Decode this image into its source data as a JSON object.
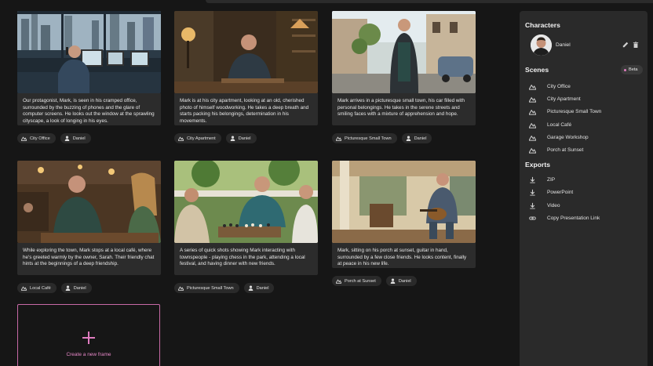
{
  "frames": [
    {
      "description": "Our protagonist, Mark, is seen in his cramped office, surrounded by the buzzing of phones and the glare of computer screens. He looks out the window at the sprawling cityscape, a look of longing in his eyes.",
      "scene_tag": "City Office",
      "character_tag": "Daniel"
    },
    {
      "description": "Mark is at his city apartment, looking at an old, cherished photo of himself woodworking. He takes a deep breath and starts packing his belongings, determination in his movements.",
      "scene_tag": "City Apartment",
      "character_tag": "Daniel"
    },
    {
      "description": "Mark arrives in a picturesque small town, his car filled with personal belongings. He takes in the serene streets and smiling faces with a mixture of apprehension and hope.",
      "scene_tag": "Picturesque Small Town",
      "character_tag": "Daniel"
    },
    {
      "description": "While exploring the town, Mark stops at a local café, where he's greeted warmly by the owner, Sarah. Their friendly chat hints at the beginnings of a deep friendship.",
      "scene_tag": "Local Café",
      "character_tag": "Daniel"
    },
    {
      "description": "A series of quick shots showing Mark interacting with townspeople - playing chess in the park, attending a local festival, and having dinner with new friends.",
      "scene_tag": "Picturesque Small Town",
      "character_tag": "Daniel"
    },
    {
      "description": "Mark, sitting on his porch at sunset, guitar in hand, surrounded by a few close friends. He looks content, finally at peace in his new life.",
      "scene_tag": "Porch at Sunset",
      "character_tag": "Daniel"
    }
  ],
  "new_frame_label": "Create a new frame",
  "sidebar": {
    "characters_title": "Characters",
    "character_name": "Daniel",
    "scenes_title": "Scenes",
    "beta_label": "Beta",
    "scenes": [
      "City Office",
      "City Apartment",
      "Picturesque Small Town",
      "Local Café",
      "Garage Workshop",
      "Porch at Sunset"
    ],
    "exports_title": "Exports",
    "exports": [
      "ZIP",
      "PowerPoint",
      "Video",
      "Copy Presentation Link"
    ]
  },
  "colors": {
    "accent": "#e07cc0",
    "background": "#161616",
    "panel": "#2a2a2a"
  },
  "icons": {
    "scene_tag": "landscape-icon",
    "character_tag": "person-icon",
    "edit": "pencil-icon",
    "delete": "trash-icon",
    "export_file": "download-icon",
    "export_link": "link-icon"
  }
}
